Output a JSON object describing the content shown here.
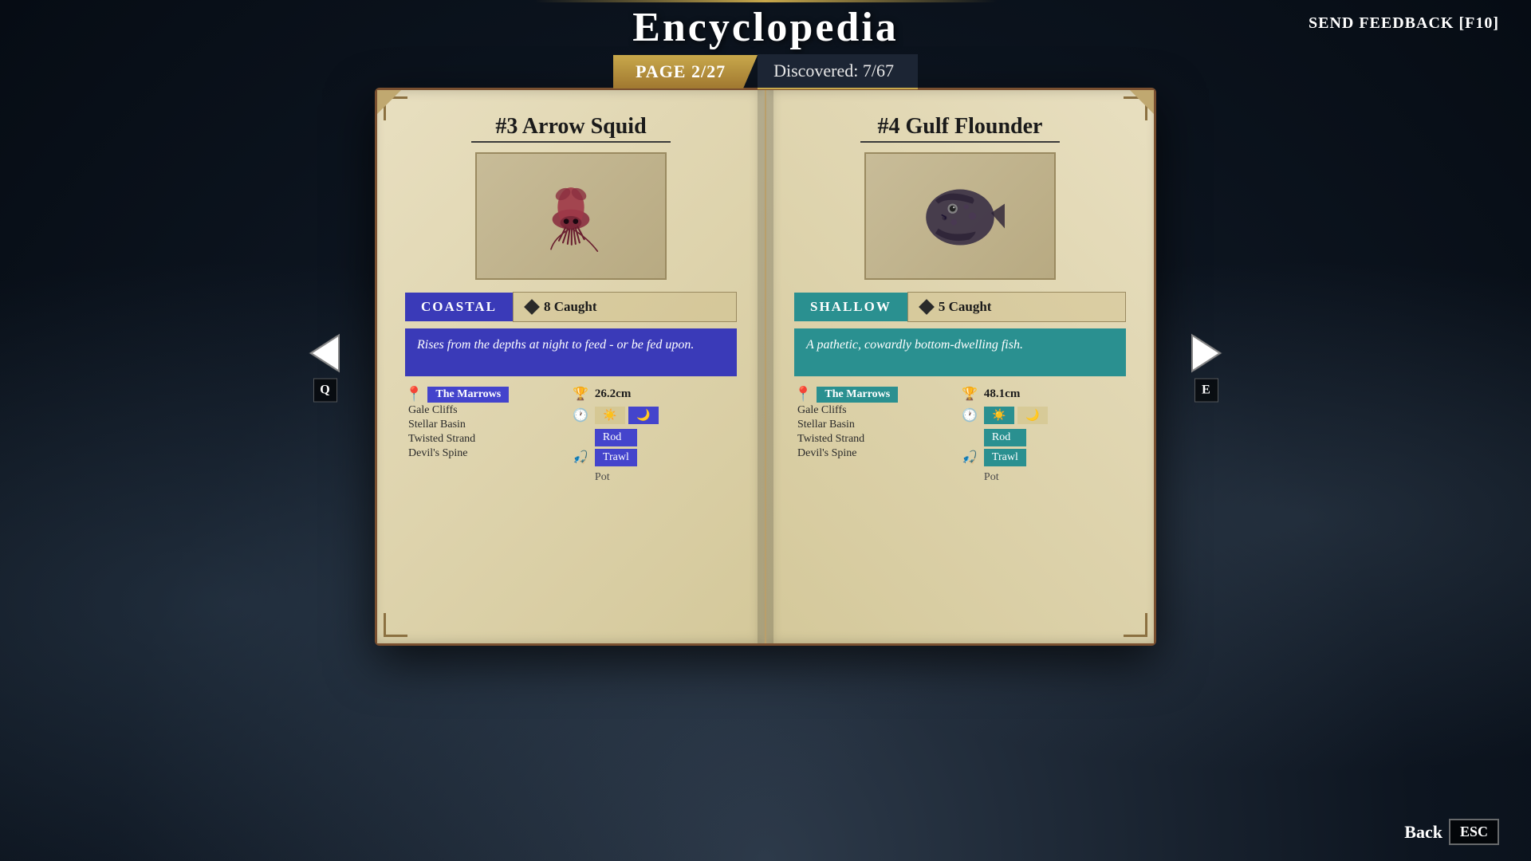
{
  "header": {
    "title": "Encyclopedia",
    "send_feedback": "SEND FEEDBACK [F10]"
  },
  "page": {
    "label": "PAGE 2/27",
    "discovered": "Discovered: 7/67"
  },
  "left_entry": {
    "number": "#3",
    "name": "Arrow Squid",
    "type": "COASTAL",
    "caught_count": "8 Caught",
    "description": "Rises from the depths at night to feed - or be fed upon.",
    "record_label": "26.2cm",
    "locations": {
      "primary": "The Marrows",
      "secondary": [
        "Gale Cliffs",
        "Stellar Basin",
        "Twisted Strand",
        "Devil's Spine"
      ]
    },
    "time": {
      "day_active": false,
      "night_active": true
    },
    "methods": {
      "rod": true,
      "trawl": true,
      "pot": false
    },
    "method_labels": [
      "Rod",
      "Trawl",
      "Pot"
    ]
  },
  "right_entry": {
    "number": "#4",
    "name": "Gulf Flounder",
    "type": "SHALLOW",
    "caught_count": "5 Caught",
    "description": "A pathetic, cowardly bottom-dwelling fish.",
    "record_label": "48.1cm",
    "locations": {
      "primary": "The Marrows",
      "secondary": [
        "Gale Cliffs",
        "Stellar Basin",
        "Twisted Strand",
        "Devil's Spine"
      ]
    },
    "time": {
      "day_active": true,
      "night_active": false
    },
    "methods": {
      "rod": true,
      "trawl": true,
      "pot": false
    },
    "method_labels": [
      "Rod",
      "Trawl",
      "Pot"
    ]
  },
  "nav": {
    "left_key": "Q",
    "right_key": "E",
    "back_label": "Back",
    "back_key": "ESC"
  }
}
